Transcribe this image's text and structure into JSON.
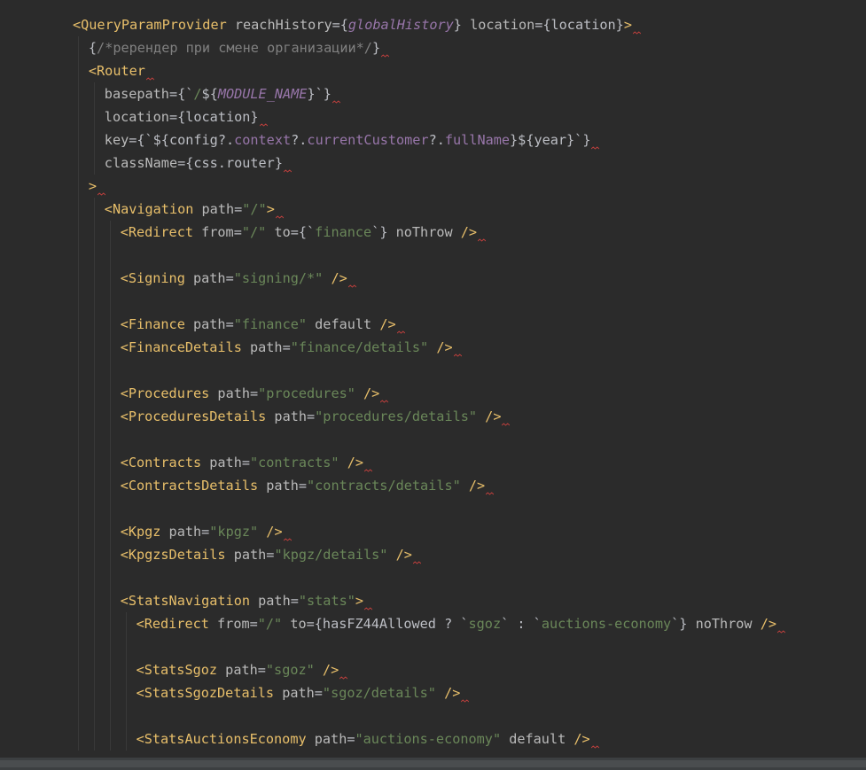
{
  "colors": {
    "background": "#2b2b2b",
    "tag": "#e8bf6a",
    "attribute": "#bababa",
    "punctuation": "#bcbec4",
    "string": "#6a8759",
    "constant": "#9876aa",
    "comment": "#808080",
    "warning_squiggle": "#bc3f3c"
  },
  "code_lines": [
    {
      "indent": 0,
      "squiggle": true,
      "tokens": [
        {
          "t": "tag",
          "v": "<QueryParamProvider"
        },
        {
          "t": "attr",
          "v": " reachHistory"
        },
        {
          "t": "punct",
          "v": "={"
        },
        {
          "t": "const",
          "v": "globalHistory"
        },
        {
          "t": "punct",
          "v": "}"
        },
        {
          "t": "attr",
          "v": " location"
        },
        {
          "t": "punct",
          "v": "={location}"
        },
        {
          "t": "tag",
          "v": ">"
        }
      ]
    },
    {
      "indent": 1,
      "squiggle": true,
      "tokens": [
        {
          "t": "punct",
          "v": "{"
        },
        {
          "t": "comment",
          "v": "/*ререндер при смене организации*/"
        },
        {
          "t": "punct",
          "v": "}"
        }
      ]
    },
    {
      "indent": 1,
      "squiggle": true,
      "tokens": [
        {
          "t": "tag",
          "v": "<Router"
        }
      ]
    },
    {
      "indent": 2,
      "squiggle": true,
      "tokens": [
        {
          "t": "attr",
          "v": "basepath"
        },
        {
          "t": "punct",
          "v": "={`"
        },
        {
          "t": "str",
          "v": "/"
        },
        {
          "t": "punct",
          "v": "${"
        },
        {
          "t": "const",
          "v": "MODULE_NAME"
        },
        {
          "t": "punct",
          "v": "}`}"
        }
      ]
    },
    {
      "indent": 2,
      "squiggle": true,
      "tokens": [
        {
          "t": "attr",
          "v": "location"
        },
        {
          "t": "punct",
          "v": "={location}"
        }
      ]
    },
    {
      "indent": 2,
      "squiggle": true,
      "tokens": [
        {
          "t": "attr",
          "v": "key"
        },
        {
          "t": "punct",
          "v": "={`${config?."
        },
        {
          "t": "prop",
          "v": "context"
        },
        {
          "t": "punct",
          "v": "?."
        },
        {
          "t": "prop",
          "v": "currentCustomer"
        },
        {
          "t": "punct",
          "v": "?."
        },
        {
          "t": "prop",
          "v": "fullName"
        },
        {
          "t": "punct",
          "v": "}${year}`}"
        }
      ]
    },
    {
      "indent": 2,
      "squiggle": true,
      "tokens": [
        {
          "t": "attr",
          "v": "className"
        },
        {
          "t": "punct",
          "v": "={css.router}"
        }
      ]
    },
    {
      "indent": 1,
      "squiggle": true,
      "tokens": [
        {
          "t": "tag",
          "v": ">"
        }
      ]
    },
    {
      "indent": 2,
      "squiggle": true,
      "tokens": [
        {
          "t": "tag",
          "v": "<Navigation"
        },
        {
          "t": "attr",
          "v": " path"
        },
        {
          "t": "punct",
          "v": "="
        },
        {
          "t": "str",
          "v": "\"/\""
        },
        {
          "t": "tag",
          "v": ">"
        }
      ]
    },
    {
      "indent": 3,
      "squiggle": true,
      "tokens": [
        {
          "t": "tag",
          "v": "<Redirect"
        },
        {
          "t": "attr",
          "v": " from"
        },
        {
          "t": "punct",
          "v": "="
        },
        {
          "t": "str",
          "v": "\"/\""
        },
        {
          "t": "attr",
          "v": " to"
        },
        {
          "t": "punct",
          "v": "={`"
        },
        {
          "t": "str",
          "v": "finance"
        },
        {
          "t": "punct",
          "v": "`}"
        },
        {
          "t": "attr",
          "v": " noThrow"
        },
        {
          "t": "tag",
          "v": " />"
        }
      ]
    },
    {
      "indent": 3,
      "squiggle": false,
      "tokens": []
    },
    {
      "indent": 3,
      "squiggle": true,
      "tokens": [
        {
          "t": "tag",
          "v": "<Signing"
        },
        {
          "t": "attr",
          "v": " path"
        },
        {
          "t": "punct",
          "v": "="
        },
        {
          "t": "str",
          "v": "\"signing/*\""
        },
        {
          "t": "tag",
          "v": " />"
        }
      ]
    },
    {
      "indent": 3,
      "squiggle": false,
      "tokens": []
    },
    {
      "indent": 3,
      "squiggle": true,
      "tokens": [
        {
          "t": "tag",
          "v": "<Finance"
        },
        {
          "t": "attr",
          "v": " path"
        },
        {
          "t": "punct",
          "v": "="
        },
        {
          "t": "str",
          "v": "\"finance\""
        },
        {
          "t": "attr",
          "v": " default"
        },
        {
          "t": "tag",
          "v": " />"
        }
      ]
    },
    {
      "indent": 3,
      "squiggle": true,
      "tokens": [
        {
          "t": "tag",
          "v": "<FinanceDetails"
        },
        {
          "t": "attr",
          "v": " path"
        },
        {
          "t": "punct",
          "v": "="
        },
        {
          "t": "str",
          "v": "\"finance/details\""
        },
        {
          "t": "tag",
          "v": " />"
        }
      ]
    },
    {
      "indent": 3,
      "squiggle": false,
      "tokens": []
    },
    {
      "indent": 3,
      "squiggle": true,
      "tokens": [
        {
          "t": "tag",
          "v": "<Procedures"
        },
        {
          "t": "attr",
          "v": " path"
        },
        {
          "t": "punct",
          "v": "="
        },
        {
          "t": "str",
          "v": "\"procedures\""
        },
        {
          "t": "tag",
          "v": " />"
        }
      ]
    },
    {
      "indent": 3,
      "squiggle": true,
      "tokens": [
        {
          "t": "tag",
          "v": "<ProceduresDetails"
        },
        {
          "t": "attr",
          "v": " path"
        },
        {
          "t": "punct",
          "v": "="
        },
        {
          "t": "str",
          "v": "\"procedures/details\""
        },
        {
          "t": "tag",
          "v": " />"
        }
      ]
    },
    {
      "indent": 3,
      "squiggle": false,
      "tokens": []
    },
    {
      "indent": 3,
      "squiggle": true,
      "tokens": [
        {
          "t": "tag",
          "v": "<Contracts"
        },
        {
          "t": "attr",
          "v": " path"
        },
        {
          "t": "punct",
          "v": "="
        },
        {
          "t": "str",
          "v": "\"contracts\""
        },
        {
          "t": "tag",
          "v": " />"
        }
      ]
    },
    {
      "indent": 3,
      "squiggle": true,
      "tokens": [
        {
          "t": "tag",
          "v": "<ContractsDetails"
        },
        {
          "t": "attr",
          "v": " path"
        },
        {
          "t": "punct",
          "v": "="
        },
        {
          "t": "str",
          "v": "\"contracts/details\""
        },
        {
          "t": "tag",
          "v": " />"
        }
      ]
    },
    {
      "indent": 3,
      "squiggle": false,
      "tokens": []
    },
    {
      "indent": 3,
      "squiggle": true,
      "tokens": [
        {
          "t": "tag",
          "v": "<Kpgz"
        },
        {
          "t": "attr",
          "v": " path"
        },
        {
          "t": "punct",
          "v": "="
        },
        {
          "t": "str",
          "v": "\"kpgz\""
        },
        {
          "t": "tag",
          "v": " />"
        }
      ]
    },
    {
      "indent": 3,
      "squiggle": true,
      "tokens": [
        {
          "t": "tag",
          "v": "<KpgzsDetails"
        },
        {
          "t": "attr",
          "v": " path"
        },
        {
          "t": "punct",
          "v": "="
        },
        {
          "t": "str",
          "v": "\"kpgz/details\""
        },
        {
          "t": "tag",
          "v": " />"
        }
      ]
    },
    {
      "indent": 3,
      "squiggle": false,
      "tokens": []
    },
    {
      "indent": 3,
      "squiggle": true,
      "tokens": [
        {
          "t": "tag",
          "v": "<StatsNavigation"
        },
        {
          "t": "attr",
          "v": " path"
        },
        {
          "t": "punct",
          "v": "="
        },
        {
          "t": "str",
          "v": "\"stats\""
        },
        {
          "t": "tag",
          "v": ">"
        }
      ]
    },
    {
      "indent": 4,
      "squiggle": true,
      "tokens": [
        {
          "t": "tag",
          "v": "<Redirect"
        },
        {
          "t": "attr",
          "v": " from"
        },
        {
          "t": "punct",
          "v": "="
        },
        {
          "t": "str",
          "v": "\"/\""
        },
        {
          "t": "attr",
          "v": " to"
        },
        {
          "t": "punct",
          "v": "={hasFZ44Allowed ? `"
        },
        {
          "t": "str",
          "v": "sgoz"
        },
        {
          "t": "punct",
          "v": "` : `"
        },
        {
          "t": "str",
          "v": "auctions-economy"
        },
        {
          "t": "punct",
          "v": "`}"
        },
        {
          "t": "attr",
          "v": " noThrow"
        },
        {
          "t": "tag",
          "v": " />"
        }
      ]
    },
    {
      "indent": 4,
      "squiggle": false,
      "tokens": []
    },
    {
      "indent": 4,
      "squiggle": true,
      "tokens": [
        {
          "t": "tag",
          "v": "<StatsSgoz"
        },
        {
          "t": "attr",
          "v": " path"
        },
        {
          "t": "punct",
          "v": "="
        },
        {
          "t": "str",
          "v": "\"sgoz\""
        },
        {
          "t": "tag",
          "v": " />"
        }
      ]
    },
    {
      "indent": 4,
      "squiggle": true,
      "tokens": [
        {
          "t": "tag",
          "v": "<StatsSgozDetails"
        },
        {
          "t": "attr",
          "v": " path"
        },
        {
          "t": "punct",
          "v": "="
        },
        {
          "t": "str",
          "v": "\"sgoz/details\""
        },
        {
          "t": "tag",
          "v": " />"
        }
      ]
    },
    {
      "indent": 4,
      "squiggle": false,
      "tokens": []
    },
    {
      "indent": 4,
      "squiggle": true,
      "tokens": [
        {
          "t": "tag",
          "v": "<StatsAuctionsEconomy"
        },
        {
          "t": "attr",
          "v": " path"
        },
        {
          "t": "punct",
          "v": "="
        },
        {
          "t": "str",
          "v": "\"auctions-economy\""
        },
        {
          "t": "attr",
          "v": " default"
        },
        {
          "t": "tag",
          "v": " />"
        }
      ]
    }
  ]
}
